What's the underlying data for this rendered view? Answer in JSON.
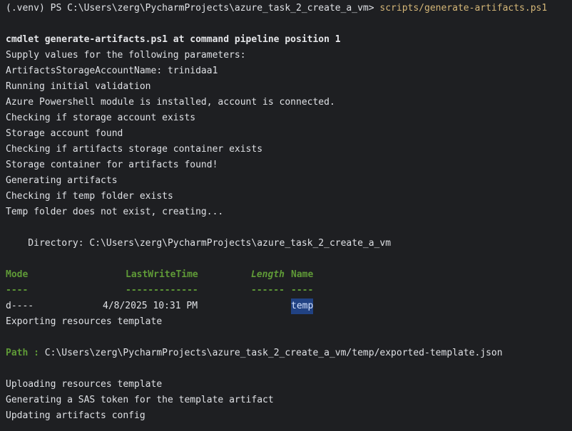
{
  "prompt": {
    "prefix": "(.venv) PS C:\\Users\\zerg\\PycharmProjects\\azure_task_2_create_a_vm> ",
    "command": "scripts/generate-artifacts.ps1"
  },
  "output": {
    "cmdlet_line": "cmdlet generate-artifacts.ps1 at command pipeline position 1",
    "supply_line": "Supply values for the following parameters:",
    "param_line": "ArtifactsStorageAccountName: trinidaa1",
    "lines_a": [
      "Running initial validation",
      "Azure Powershell module is installed, account is connected.",
      "Checking if storage account exists",
      "Storage account found",
      "Checking if artifacts storage container exists",
      "Storage container for artifacts found!",
      "Generating artifacts",
      "Checking if temp folder exists",
      "Temp folder does not exist, creating..."
    ],
    "directory_line": "    Directory: C:\\Users\\zerg\\PycharmProjects\\azure_task_2_create_a_vm",
    "table": {
      "headers": {
        "mode": "Mode",
        "lastwritetime": "LastWriteTime",
        "length": "Length",
        "name": "Name"
      },
      "underlines": {
        "mode": "----",
        "lastwritetime": "-------------",
        "length": "------",
        "name": "----"
      },
      "row": {
        "mode": "d----",
        "lastwritetime": "4/8/2025 10:31 PM",
        "length": "",
        "name": "temp"
      }
    },
    "exporting_line": "Exporting resources template",
    "path_label": "Path : ",
    "path_value": "C:\\Users\\zerg\\PycharmProjects\\azure_task_2_create_a_vm/temp/exported-template.json",
    "lines_b": [
      "Uploading resources template",
      "Generating a SAS token for the template artifact",
      "Updating artifacts config"
    ]
  },
  "colors": {
    "background": "#1e1f22",
    "text": "#dfe1e5",
    "command": "#d5b778",
    "header_green": "#5f9a37",
    "selection": "#214283"
  }
}
